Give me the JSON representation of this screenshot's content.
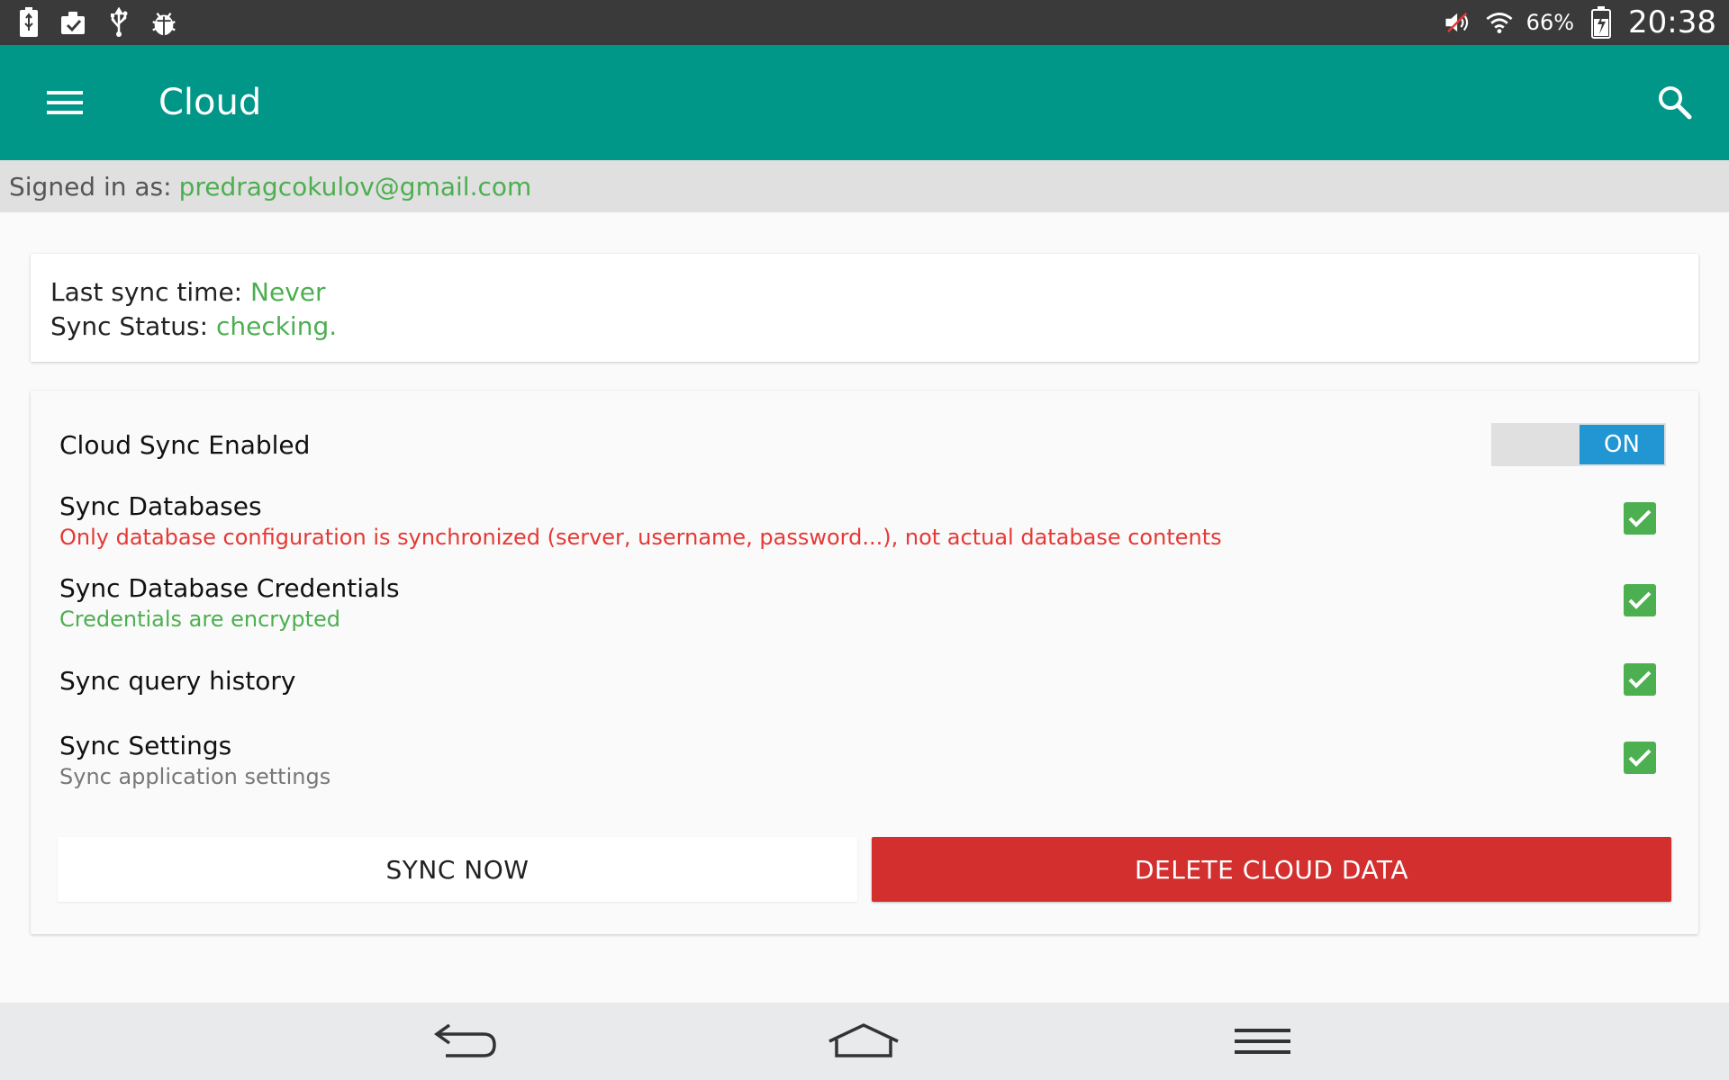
{
  "status_bar": {
    "left_icons": [
      "battery-charging-icon",
      "clipboard-check-icon",
      "usb-icon",
      "android-debug-icon"
    ],
    "right_icons": [
      "volume-muted-icon",
      "wifi-icon",
      "battery-icon"
    ],
    "battery_percent": "66%",
    "time": "20:38"
  },
  "app_bar": {
    "title": "Cloud",
    "menu_icon": "hamburger-menu-icon",
    "search_icon": "search-icon",
    "color": "#009688"
  },
  "account": {
    "label": "Signed in as:",
    "email": "predragcokulov@gmail.com"
  },
  "sync_info": {
    "last_sync_label": "Last sync time:",
    "last_sync_value": "Never",
    "status_label": "Sync Status:",
    "status_value": "checking."
  },
  "settings": {
    "cloud_sync": {
      "label": "Cloud Sync Enabled",
      "toggle_text": "ON",
      "enabled": true
    },
    "items": [
      {
        "title": "Sync Databases",
        "subtitle": "Only database configuration is synchronized (server, username, password...), not actual database contents",
        "checked": true
      },
      {
        "title": "Sync Database Credentials",
        "subtitle": "Credentials are encrypted",
        "checked": true
      },
      {
        "title": "Sync query history",
        "subtitle": "",
        "checked": true
      },
      {
        "title": "Sync Settings",
        "subtitle": "Sync application settings",
        "checked": true
      }
    ]
  },
  "actions": {
    "sync_now": "SYNC NOW",
    "delete_cloud_data": "DELETE CLOUD DATA"
  },
  "nav_bar": {
    "icons": [
      "back-icon",
      "home-icon",
      "menu-icon"
    ]
  },
  "colors": {
    "accent_green": "#4caf50",
    "error_red": "#e53935",
    "delete_button": "#d32f2f",
    "toggle_blue": "#2196d3"
  }
}
